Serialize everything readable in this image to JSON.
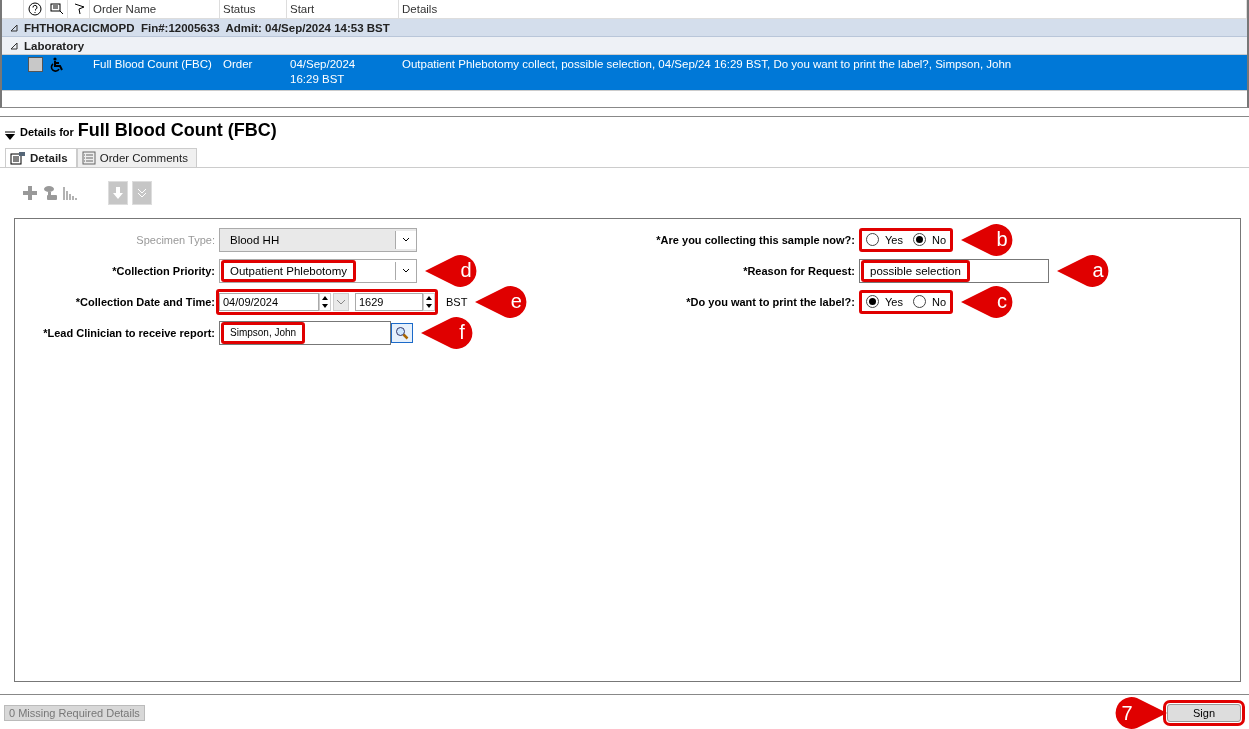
{
  "grid": {
    "columns": [
      "Order Name",
      "Status",
      "Start",
      "Details"
    ],
    "group": {
      "title": "FHTHORACICMOPD  Fin#:12005633  Admit: 04/Sep/2024 14:53 BST",
      "expanded": true
    },
    "subgroup": {
      "title": "Laboratory",
      "expanded": true
    },
    "orders": [
      {
        "name": "Full Blood Count (FBC)",
        "status": "Order",
        "start": "04/Sep/2024 16:29 BST",
        "details": "Outpatient Phlebotomy collect, possible selection, 04/Sep/24 16:29 BST, Do you want to print the label?, Simpson, John",
        "selected": true,
        "checked": false
      }
    ]
  },
  "details": {
    "prefix": "Details for",
    "title": "Full Blood Count (FBC)",
    "expanded": true
  },
  "tabs": [
    {
      "label": "Details",
      "selected": true
    },
    {
      "label": "Order Comments",
      "selected": false
    }
  ],
  "left_fields": [
    {
      "kind": "dropdown",
      "label": "Specimen Type:",
      "value": "Blood HH",
      "disabled": true,
      "highlighted": false
    },
    {
      "kind": "dropdown",
      "label": "*Collection Priority:",
      "value": "Outpatient Phlebotomy",
      "disabled": false,
      "highlighted": true,
      "callout": "d"
    },
    {
      "kind": "datetime",
      "label": "*Collection Date and Time:",
      "date": "04/09/2024",
      "time": "1629",
      "zone": "BST",
      "disabled": false,
      "highlighted": true,
      "callout": "e"
    },
    {
      "kind": "lookup",
      "label": "*Lead Clinician to receive report:",
      "value": "Simpson, John",
      "disabled": false,
      "highlighted": true,
      "callout": "f"
    }
  ],
  "right_fields": [
    {
      "kind": "radio",
      "label": "*Are you collecting this sample now?:",
      "options": [
        {
          "label": "Yes",
          "selected": false
        },
        {
          "label": "No",
          "selected": true
        }
      ],
      "highlighted": true,
      "callout": "b"
    },
    {
      "kind": "text",
      "label": "*Reason for Request:",
      "value": "possible selection",
      "highlighted": true,
      "callout": "a"
    },
    {
      "kind": "radio",
      "label": "*Do you want to print the label?:",
      "options": [
        {
          "label": "Yes",
          "selected": true
        },
        {
          "label": "No",
          "selected": false
        }
      ],
      "highlighted": true,
      "callout": "c"
    }
  ],
  "footer": {
    "status": "0 Missing Required Details",
    "sign_button": "Sign",
    "highlighted": true,
    "callout": "7"
  }
}
